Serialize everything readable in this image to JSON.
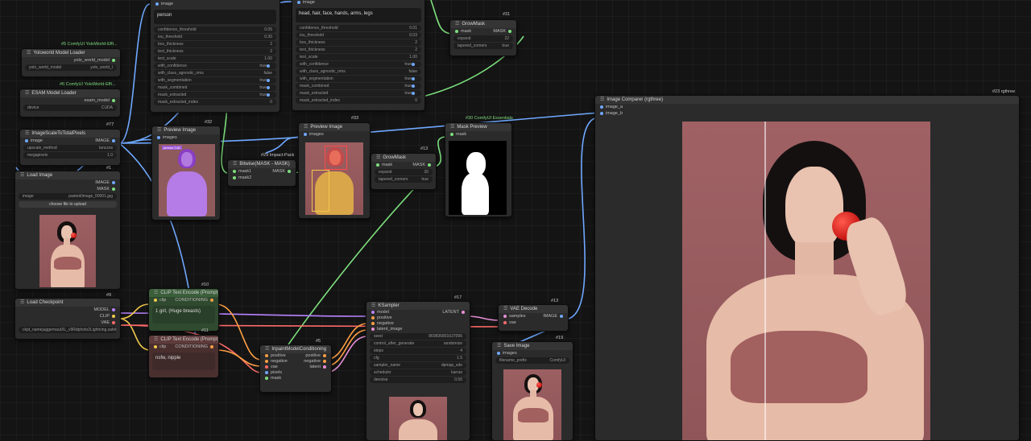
{
  "nodes": {
    "yolo_loader": {
      "id": "#5 ComfyUI YoloWorld-Effi...",
      "title": "Yoloworld Model Loader",
      "out": "yolo_world_model",
      "widget_label": "yolo_world_model",
      "widget_value": "yolo_world_l"
    },
    "esam_loader": {
      "id": "#6 ComfyUI YoloWorld-Effi...",
      "title": "ESAM Model Loader",
      "out": "esam_model",
      "widget_label": "device",
      "widget_value": "CUDA"
    },
    "scale": {
      "id": "#77",
      "title": "ImageScaleToTotalPixels",
      "in": "image",
      "out": "IMAGE",
      "w1_label": "upscale_method",
      "w1_value": "lanczos",
      "w2_label": "megapixels",
      "w2_value": "1.0"
    },
    "load_image": {
      "id": "#1",
      "title": "Load Image",
      "out1": "IMAGE",
      "out2": "MASK",
      "widget_label": "image",
      "widget_value": "pasted/image_00001.jpg",
      "upload": "choose file to upload"
    },
    "yolo_detect1": {
      "in": "image",
      "prompt": "person",
      "rows": [
        {
          "k": "confidence_threshold",
          "v": "0.05"
        },
        {
          "k": "iou_threshold",
          "v": "0.30"
        },
        {
          "k": "box_thickness",
          "v": "2"
        },
        {
          "k": "text_thickness",
          "v": "2"
        },
        {
          "k": "text_scale",
          "v": "1.00"
        },
        {
          "k": "with_confidence",
          "v": "true"
        },
        {
          "k": "with_class_agnostic_nms",
          "v": "false"
        },
        {
          "k": "with_segmentation",
          "v": "true"
        },
        {
          "k": "mask_combined",
          "v": "true"
        },
        {
          "k": "mask_extracted",
          "v": "true"
        },
        {
          "k": "mask_extracted_index",
          "v": "0"
        }
      ]
    },
    "yolo_detect2": {
      "in": "image",
      "prompt": "head, hair, face, hands, arms, legs",
      "rows": [
        {
          "k": "confidence_threshold",
          "v": "0.01"
        },
        {
          "k": "iou_threshold",
          "v": "0.03"
        },
        {
          "k": "box_thickness",
          "v": "2"
        },
        {
          "k": "text_thickness",
          "v": "2"
        },
        {
          "k": "text_scale",
          "v": "1.00"
        },
        {
          "k": "with_confidence",
          "v": "true"
        },
        {
          "k": "with_class_agnostic_nms",
          "v": "false"
        },
        {
          "k": "with_segmentation",
          "v": "true"
        },
        {
          "k": "mask_combined",
          "v": "true"
        },
        {
          "k": "mask_extracted",
          "v": "true"
        },
        {
          "k": "mask_extracted_index",
          "v": "0"
        }
      ]
    },
    "growmask_top": {
      "id": "#31",
      "title": "GrowMask",
      "in": "mask",
      "out": "MASK",
      "w1_label": "expand",
      "w1_value": "22",
      "w2_label": "tapered_corners",
      "w2_value": "true"
    },
    "preview1": {
      "id": "#32",
      "title": "Preview Image",
      "in": "images"
    },
    "preview2": {
      "id": "#33",
      "title": "Preview Image",
      "in": "images"
    },
    "bitwise": {
      "id": "#29 Impact-Pack",
      "title": "Bitwise(MASK - MASK)",
      "in1": "mask1",
      "in2": "mask2",
      "out": "MASK"
    },
    "growmask2": {
      "id": "#13",
      "title": "GrowMask",
      "in": "mask",
      "out": "MASK",
      "w1_label": "expand",
      "w1_value": "20",
      "w2_label": "tapered_corners",
      "w2_value": "true"
    },
    "mask_preview": {
      "id": "#30 ComfyUI Essentials",
      "title": "Mask Preview",
      "in": "mask"
    },
    "compare": {
      "id": "#23 rgthree",
      "title": "Image Comparer (rgthree)",
      "in1": "image_a",
      "in2": "image_b"
    },
    "checkpoint": {
      "id": "#9",
      "title": "Load Checkpoint",
      "out1": "MODEL",
      "out2": "CLIP",
      "out3": "VAE",
      "widget_label": "ckpt_name",
      "widget_value": "juggernautXL_v9Rdphoto2Lightning.safetensors"
    },
    "clip_pos": {
      "id": "#10",
      "title": "CLIP Text Encode (Prompt)",
      "in": "clip",
      "out": "CONDITIONING",
      "text": "1 girl, (Huge breasts)"
    },
    "clip_neg": {
      "id": "#11",
      "title": "CLIP Text Encode (Prompt)",
      "in": "clip",
      "out": "CONDITIONING",
      "text": "nsfw, nipple"
    },
    "inpaint_cond": {
      "id": "#5",
      "title": "InpaintModelConditioning",
      "ins": [
        "positive",
        "negative",
        "vae",
        "pixels",
        "mask"
      ],
      "outs": [
        "positive",
        "negative",
        "latent"
      ]
    },
    "ksampler": {
      "id": "#17",
      "title": "KSampler",
      "ins": [
        "model",
        "positive",
        "negative",
        "latent_image"
      ],
      "out": "LATENT",
      "rows": [
        {
          "k": "seed",
          "v": "869836801637096"
        },
        {
          "k": "control_after_generate",
          "v": "randomize"
        },
        {
          "k": "steps",
          "v": "4"
        },
        {
          "k": "cfg",
          "v": "1.5"
        },
        {
          "k": "sampler_name",
          "v": "dpmpp_sde"
        },
        {
          "k": "scheduler",
          "v": "karras"
        },
        {
          "k": "denoise",
          "v": "0.50"
        }
      ]
    },
    "vae_decode": {
      "id": "#13",
      "title": "VAE Decode",
      "in1": "samples",
      "in2": "vae",
      "out": "IMAGE"
    },
    "save_image": {
      "id": "#19",
      "title": "Save Image",
      "in": "images",
      "widget_label": "filename_prefix",
      "widget_value": "ComfyUI"
    }
  },
  "colors": {
    "image": "#6fa8ff",
    "mask": "#7de07d",
    "model": "#b983ff",
    "clip": "#f2c94c",
    "vae": "#ff6b6b",
    "conditioning": "#ff9f43",
    "latent": "#e58fd6"
  },
  "badges": {
    "person_label": "person 0.81"
  }
}
